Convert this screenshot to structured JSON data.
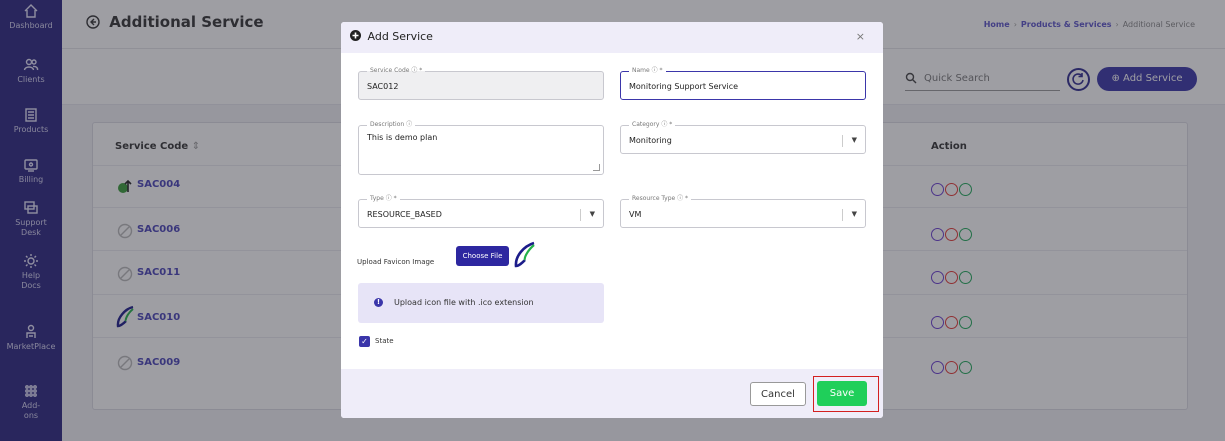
{
  "sidebar": {
    "items": [
      {
        "label": "Dashboard",
        "icon": "home-icon"
      },
      {
        "label": "Clients",
        "icon": "users-icon"
      },
      {
        "label": "Products",
        "icon": "box-icon"
      },
      {
        "label": "Billing",
        "icon": "billing-icon"
      },
      {
        "label": "Support Desk",
        "icon": "support-icon"
      },
      {
        "label": "Help Docs",
        "icon": "gear-icon"
      },
      {
        "label": "MarketPlace",
        "icon": "marketplace-icon"
      },
      {
        "label": "Add-ons",
        "icon": "grid-icon"
      }
    ]
  },
  "header": {
    "title": "Additional Service",
    "breadcrumb": {
      "home": "Home",
      "section": "Products & Services",
      "current": "Additional Service"
    }
  },
  "toolbar": {
    "search_placeholder": "Quick Search",
    "add_label": "Add Service"
  },
  "table": {
    "headers": {
      "code": "Service Code",
      "action": "Action"
    },
    "rows": [
      {
        "code": "SAC004"
      },
      {
        "code": "SAC006"
      },
      {
        "code": "SAC011"
      },
      {
        "code": "SAC010"
      },
      {
        "code": "SAC009"
      }
    ]
  },
  "modal": {
    "title": "Add Service",
    "close": "×",
    "fields": {
      "service_code": {
        "label": "Service Code ⓘ *",
        "value": "SAC012"
      },
      "name": {
        "label": "Name ⓘ *",
        "value": "Monitoring Support Service"
      },
      "description": {
        "label": "Description ⓘ",
        "value": "This is demo plan"
      },
      "category": {
        "label": "Category ⓘ *",
        "value": "Monitoring"
      },
      "type": {
        "label": "Type ⓘ *",
        "value": "RESOURCE_BASED"
      },
      "resource_type": {
        "label": "Resource Type ⓘ *",
        "value": "VM"
      }
    },
    "upload": {
      "label": "Upload Favicon Image",
      "button": "Choose File"
    },
    "info": "Upload icon file with .ico extension",
    "state_label": "State",
    "cancel": "Cancel",
    "save": "Save"
  },
  "colors": {
    "sidebar": "#2b2580",
    "accent": "#3b36aa",
    "save": "#1fcf5a",
    "highlight": "#d32020"
  }
}
